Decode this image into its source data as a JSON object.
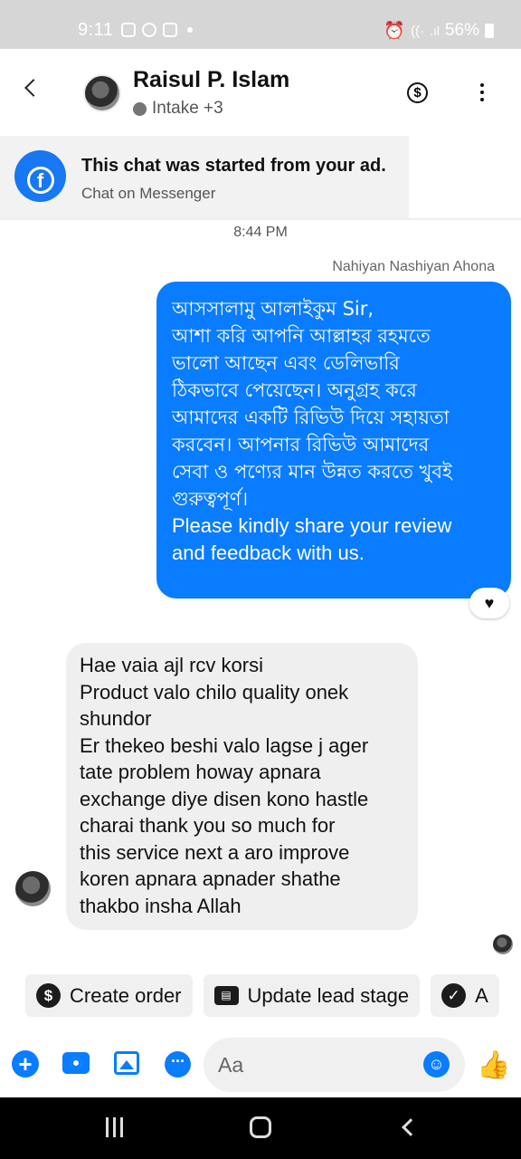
{
  "status_bar": {
    "time": "9:11",
    "battery": "56%",
    "icons": [
      "instagram-icon",
      "whatsapp-icon",
      "gallery-icon",
      "alarm-icon",
      "wifi-icon",
      "signal-icon",
      "battery-icon"
    ]
  },
  "header": {
    "name": "Raisul P. Islam",
    "label_text": "Intake +3",
    "icons": [
      "back-icon",
      "dollar-icon",
      "more-icon"
    ]
  },
  "ad_banner": {
    "title": "This chat was started from your ad.",
    "subtitle": "Chat on Messenger"
  },
  "conversation": {
    "timestamp": "8:44 PM",
    "sender_name": "Nahiyan Nashiyan Ahona",
    "outgoing_lines": [
      "আসসালামু আলাইকুম Sir,",
      "আশা করি আপনি আল্লাহর রহমতে",
      "ভালো আছেন এবং ডেলিভারি",
      "ঠিকভাবে পেয়েছেন। অনুগ্রহ করে",
      "আমাদের একটি রিভিউ দিয়ে সহায়তা",
      "করবেন। আপনার রিভিউ আমাদের",
      "সেবা ও পণ্যের মান উন্নত করতে খুবই",
      "গুরুত্বপূর্ণ।",
      "Please kindly share your review",
      "and feedback with us."
    ],
    "reaction": "♥",
    "incoming_lines": [
      "Hae vaia ajl rcv korsi",
      "Product valo chilo quality onek",
      "shundor",
      "Er thekeo beshi valo lagse j ager",
      "tate problem howay apnara",
      "exchange diye disen kono hastle",
      "charai thank you so much for",
      "this service next a aro improve",
      "koren apnara apnader shathe",
      "thakbo insha Allah"
    ]
  },
  "quick_actions": {
    "create_order": "Create order",
    "update_lead": "Update lead stage",
    "third_partial": "A"
  },
  "composer": {
    "placeholder": "Aa",
    "icons": [
      "plus-icon",
      "camera-icon",
      "image-icon",
      "chat-bubble-icon",
      "emoji-icon",
      "thumbs-up-icon"
    ]
  },
  "colors": {
    "messenger_blue": "#0a7cff",
    "facebook_blue": "#1877f2",
    "incoming_bubble": "#efefef"
  }
}
